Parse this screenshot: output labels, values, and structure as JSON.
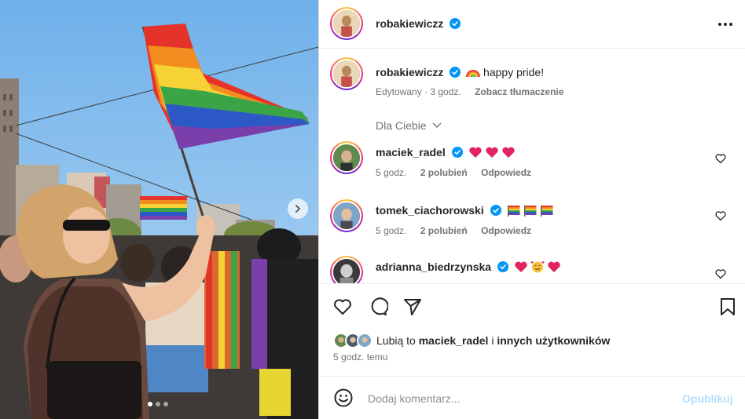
{
  "post": {
    "author": "robakiewiczz",
    "caption_emoji_icon": "rainbow-icon",
    "caption": "happy pride!",
    "edited": "Edytowany · 3 godz.",
    "translate": "Zobacz tłumaczenie",
    "photo_pages": 3,
    "photo_active_page": 1
  },
  "comments_header": {
    "filter": "Dla Ciebie"
  },
  "comments": [
    {
      "user": "maciek_radel",
      "emoji_icons": [
        "red-heart-icon",
        "red-heart-icon",
        "red-heart-icon"
      ],
      "time": "5 godz.",
      "likes": "2 polubień",
      "reply": "Odpowiedz"
    },
    {
      "user": "tomek_ciachorowski",
      "emoji_icons": [
        "rainbow-flag-icon",
        "rainbow-flag-icon",
        "rainbow-flag-icon"
      ],
      "time": "5 godz.",
      "likes": "2 polubień",
      "reply": "Odpowiedz"
    },
    {
      "user": "adrianna_biedrzynska",
      "emoji_icons": [
        "red-heart-icon",
        "smiling-face-with-hearts-icon",
        "red-heart-icon"
      ]
    }
  ],
  "likes_summary": {
    "prefix": "Lubią to",
    "user": "maciek_radel",
    "connector": "i",
    "others": "innych użytkowników"
  },
  "timestamp": "5 godz. temu",
  "add_comment": {
    "placeholder": "Dodaj komentarz...",
    "publish": "Opublikuj"
  },
  "colors": {
    "verified": "#0095f6",
    "heart": "#e0245e",
    "publish_disabled": "#b2dffc",
    "muted_text": "#737373"
  }
}
